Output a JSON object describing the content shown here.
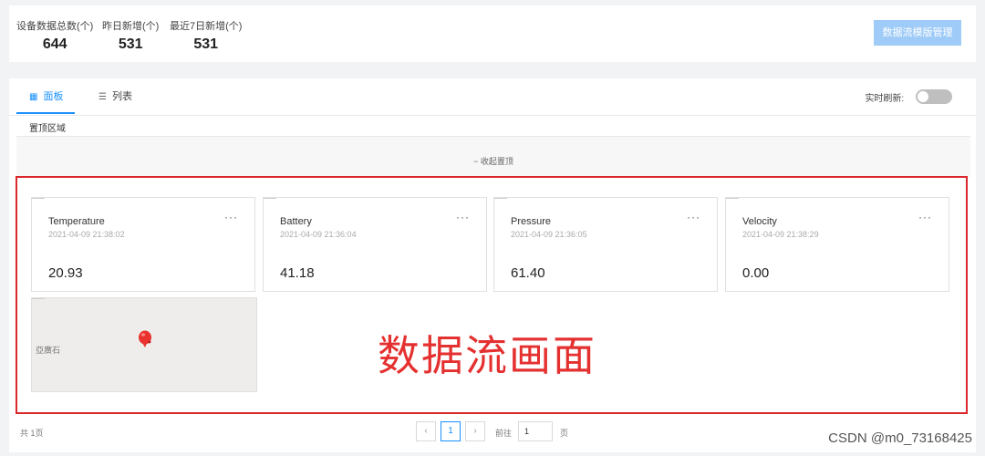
{
  "stats": [
    {
      "label": "设备数据总数(个)",
      "value": "644"
    },
    {
      "label": "昨日新增(个)",
      "value": "531"
    },
    {
      "label": "最近7日新增(个)",
      "value": "531"
    }
  ],
  "primary_button": "数据流模版管理",
  "tabs": [
    {
      "label": "面板",
      "icon": "grid-icon",
      "active": true
    },
    {
      "label": "列表",
      "icon": "list-icon",
      "active": false
    }
  ],
  "realtime_refresh": {
    "label": "实时刷新:",
    "on": false
  },
  "pinned": {
    "label": "置顶区域",
    "collapse": "收起置顶"
  },
  "cards": [
    {
      "name": "Temperature",
      "time": "2021-04-09 21:38:02",
      "value": "20.93"
    },
    {
      "name": "Battery",
      "time": "2021-04-09 21:36:04",
      "value": "41.18"
    },
    {
      "name": "Pressure",
      "time": "2021-04-09 21:36:05",
      "value": "61.40"
    },
    {
      "name": "Velocity",
      "time": "2021-04-09 21:38:29",
      "value": "0.00"
    }
  ],
  "map_card": {
    "label": "亞廣石"
  },
  "annotation": "数据流画面",
  "pagination": {
    "total": "共 1页",
    "prev": "‹",
    "page": "1",
    "next": "›",
    "goto": "前往",
    "goto_value": "1",
    "page_suffix": "页"
  },
  "watermark": "CSDN @m0_73168425",
  "colors": {
    "accent": "#1890ff",
    "annotation": "#d9272b",
    "button": "#9ecbf7"
  }
}
